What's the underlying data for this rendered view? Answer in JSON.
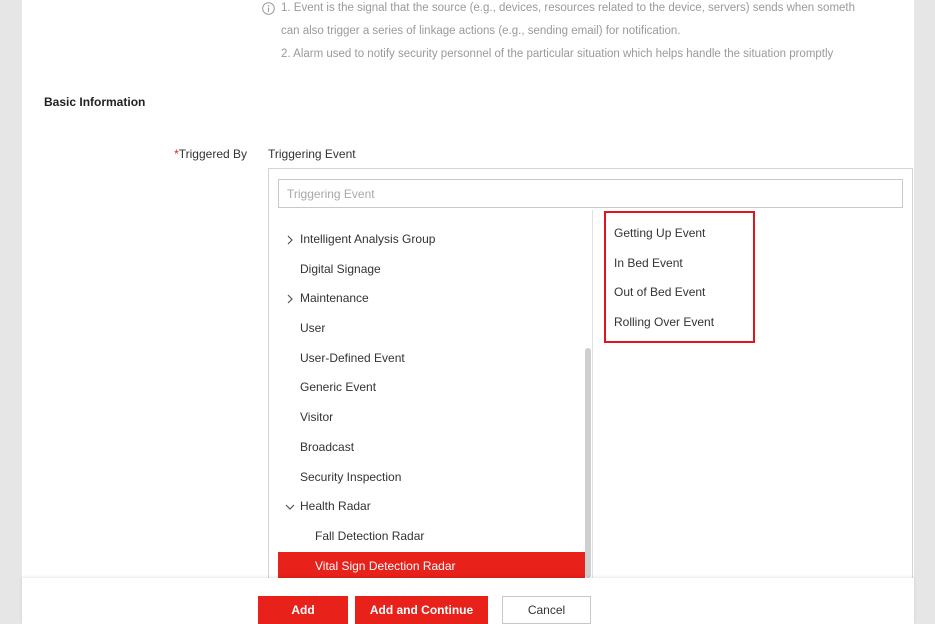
{
  "colors": {
    "accent": "#e8211b",
    "annotation_box": "#e0141e"
  },
  "info": {
    "icon": "info-circle-icon",
    "lines": [
      "1. Event is the signal that the source (e.g., devices, resources related to the device, servers) sends when someth",
      "can also trigger a series of linkage actions (e.g., sending email) for notification.",
      "2. Alarm used to notify security personnel of the particular situation which helps handle the situation promptly"
    ]
  },
  "basic_info": {
    "heading": "Basic Information"
  },
  "triggered_by": {
    "required_mark": "*",
    "label": "Triggered By",
    "value": "Triggering Event"
  },
  "event_picker": {
    "search_placeholder": "Triggering Event",
    "categories": [
      {
        "label": "Intelligent Analysis Group",
        "expander": "collapsed",
        "icon": "chevron-right-icon"
      },
      {
        "label": "Digital Signage"
      },
      {
        "label": "Maintenance",
        "expander": "collapsed",
        "icon": "chevron-right-icon"
      },
      {
        "label": "User"
      },
      {
        "label": "User-Defined Event"
      },
      {
        "label": "Generic Event"
      },
      {
        "label": "Visitor"
      },
      {
        "label": "Broadcast"
      },
      {
        "label": "Security Inspection"
      },
      {
        "label": "Health Radar",
        "expander": "expanded",
        "icon": "chevron-down-icon"
      },
      {
        "label": "Fall Detection Radar",
        "level": 1
      },
      {
        "label": "Vital Sign Detection Radar",
        "level": 1,
        "selected": true
      }
    ],
    "events": [
      "Getting Up Event",
      "In Bed Event",
      "Out of Bed Event",
      "Rolling Over Event"
    ]
  },
  "footer": {
    "add": "Add",
    "add_continue": "Add and Continue",
    "cancel": "Cancel"
  }
}
